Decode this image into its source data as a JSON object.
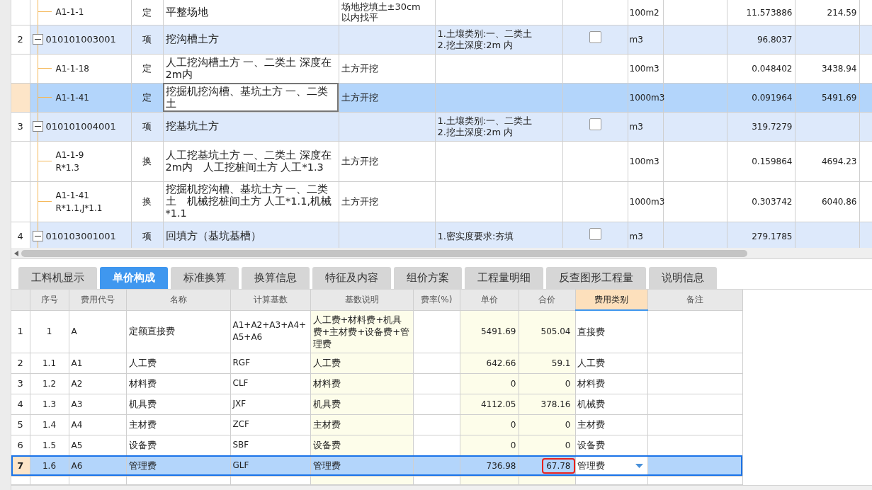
{
  "top_table": {
    "rows": [
      {
        "kind": "quota",
        "code": "A1-1-1",
        "type": "定",
        "name": "平整场地",
        "content": "场地挖填土±30cm\n以内找平",
        "unit": "100m2",
        "quantity": "11.573886",
        "price": "214.59",
        "selected": false
      },
      {
        "kind": "item",
        "index": "2",
        "expanded": true,
        "code": "010101003001",
        "type": "项",
        "name": "挖沟槽土方",
        "features": "1.土壤类别:一、二类土\n2.挖土深度:2m 内",
        "checked": false,
        "unit": "m3",
        "quantity": "96.8037",
        "selected": false
      },
      {
        "kind": "quota",
        "code": "A1-1-18",
        "type": "定",
        "name": "人工挖沟槽土方 一、二类土 深度在2m内",
        "content": "土方开挖",
        "unit": "100m3",
        "quantity": "0.048402",
        "price": "3438.94",
        "selected": false
      },
      {
        "kind": "quota",
        "code": "A1-1-41",
        "type": "定",
        "name": "挖掘机挖沟槽、基坑土方 一、二类土",
        "content": "土方开挖",
        "unit": "1000m3",
        "quantity": "0.091964",
        "price": "5491.69",
        "selected": true
      },
      {
        "kind": "item",
        "index": "3",
        "expanded": true,
        "code": "010101004001",
        "type": "项",
        "name": "挖基坑土方",
        "features": "1.土壤类别:一、二类土\n2.挖土深度:2m 内",
        "checked": false,
        "unit": "m3",
        "quantity": "319.7279",
        "selected": false
      },
      {
        "kind": "quota",
        "code": "A1-1-9\nR*1.3",
        "type": "换",
        "name": "人工挖基坑土方 一、二类土 深度在2m内　人工挖桩间土方 人工*1.3",
        "content": "土方开挖",
        "unit": "100m3",
        "quantity": "0.159864",
        "price": "4694.23",
        "selected": false
      },
      {
        "kind": "quota",
        "code": "A1-1-41\nR*1.1,J*1.1",
        "type": "换",
        "name": "挖掘机挖沟槽、基坑土方 一、二类土　机械挖桩间土方 人工*1.1,机械*1.1",
        "content": "土方开挖",
        "unit": "1000m3",
        "quantity": "0.303742",
        "price": "6040.86",
        "selected": false
      },
      {
        "kind": "item",
        "index": "4",
        "expanded": true,
        "code": "010103001001",
        "type": "项",
        "name": "回填方（基坑基槽）",
        "features": "1.密实度要求:夯填",
        "checked": false,
        "unit": "m3",
        "quantity": "279.1785",
        "selected": false
      }
    ]
  },
  "tabs": [
    {
      "label": "工料机显示",
      "selected": false
    },
    {
      "label": "单价构成",
      "selected": true
    },
    {
      "label": "标准换算",
      "selected": false
    },
    {
      "label": "换算信息",
      "selected": false
    },
    {
      "label": "特征及内容",
      "selected": false
    },
    {
      "label": "组价方案",
      "selected": false
    },
    {
      "label": "工程量明细",
      "selected": false
    },
    {
      "label": "反查图形工程量",
      "selected": false
    },
    {
      "label": "说明信息",
      "selected": false
    }
  ],
  "cost_table": {
    "columns": [
      {
        "label": "序号",
        "active": false
      },
      {
        "label": "费用代号",
        "active": false
      },
      {
        "label": "名称",
        "active": false
      },
      {
        "label": "计算基数",
        "active": false
      },
      {
        "label": "基数说明",
        "active": false
      },
      {
        "label": "费率(%)",
        "active": false
      },
      {
        "label": "单价",
        "active": false
      },
      {
        "label": "合价",
        "active": false
      },
      {
        "label": "费用类别",
        "active": true
      },
      {
        "label": "备注",
        "active": false
      }
    ],
    "rows": [
      {
        "num": "1",
        "seq": "1",
        "code": "A",
        "name": "定额直接费",
        "base": "A1+A2+A3+A4+A5+A6",
        "base_desc": "人工费+材料费+机具费+主材费+设备费+管理费",
        "price": "5491.69",
        "total": "505.04",
        "category": "直接费",
        "selected": false,
        "total_highlighted": false
      },
      {
        "num": "2",
        "seq": "1.1",
        "code": "A1",
        "name": "人工费",
        "base": "RGF",
        "base_desc": "人工费",
        "price": "642.66",
        "total": "59.1",
        "category": "人工费",
        "selected": false,
        "total_highlighted": false
      },
      {
        "num": "3",
        "seq": "1.2",
        "code": "A2",
        "name": "材料费",
        "base": "CLF",
        "base_desc": "材料费",
        "price": "0",
        "total": "0",
        "category": "材料费",
        "selected": false,
        "total_highlighted": false
      },
      {
        "num": "4",
        "seq": "1.3",
        "code": "A3",
        "name": "机具费",
        "base": "JXF",
        "base_desc": "机具费",
        "price": "4112.05",
        "total": "378.16",
        "category": "机械费",
        "selected": false,
        "total_highlighted": false
      },
      {
        "num": "5",
        "seq": "1.4",
        "code": "A4",
        "name": "主材费",
        "base": "ZCF",
        "base_desc": "主材费",
        "price": "0",
        "total": "0",
        "category": "主材费",
        "selected": false,
        "total_highlighted": false
      },
      {
        "num": "6",
        "seq": "1.5",
        "code": "A5",
        "name": "设备费",
        "base": "SBF",
        "base_desc": "设备费",
        "price": "0",
        "total": "0",
        "category": "设备费",
        "selected": false,
        "total_highlighted": false
      },
      {
        "num": "7",
        "seq": "1.6",
        "code": "A6",
        "name": "管理费",
        "base": "GLF",
        "base_desc": "管理费",
        "price": "736.98",
        "total": "67.78",
        "category": "管理费",
        "selected": true,
        "total_highlighted": true
      }
    ]
  }
}
